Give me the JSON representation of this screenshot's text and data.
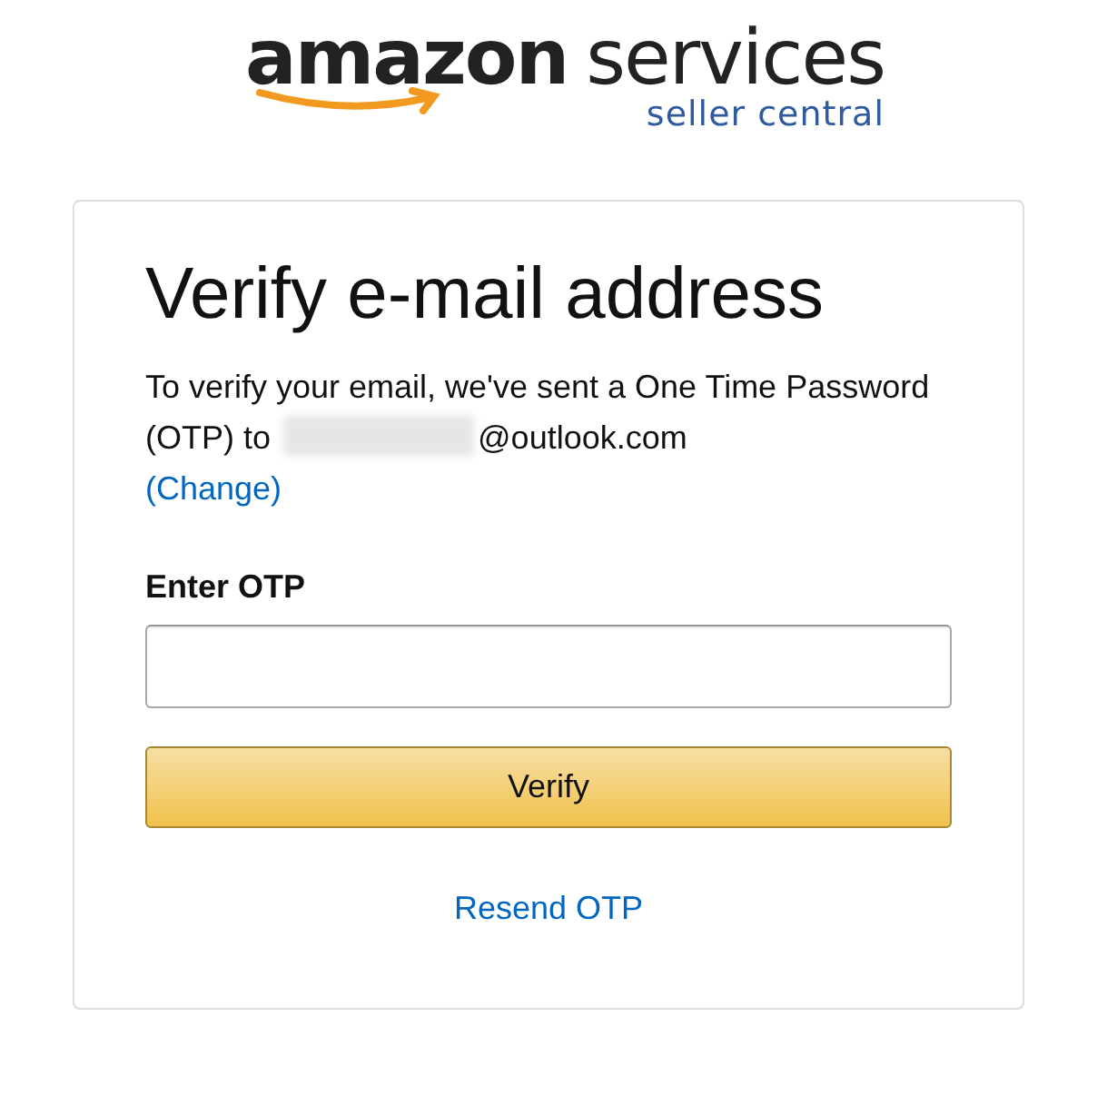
{
  "logo": {
    "brand": "amazon",
    "product": "services",
    "tagline": "seller central"
  },
  "card": {
    "title": "Verify e-mail address",
    "message": {
      "intro": "To verify your email, we've sent a One Time Password (OTP) to",
      "redacted": true,
      "email_suffix": "@outlook.com"
    },
    "change_link": "(Change)",
    "otp_field": {
      "label": "Enter OTP"
    },
    "verify_button": "Verify",
    "resend_link": "Resend OTP"
  }
}
